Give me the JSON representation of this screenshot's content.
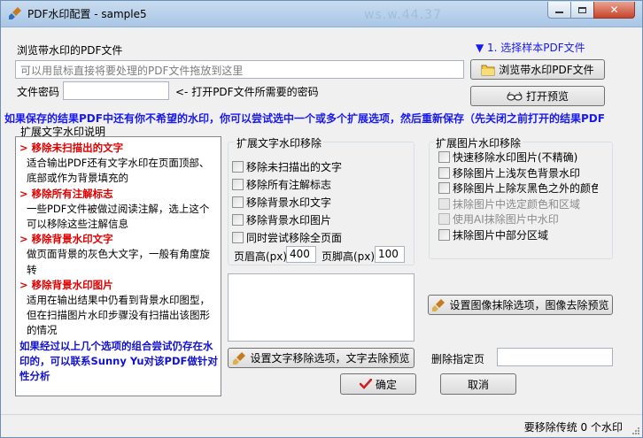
{
  "window": {
    "title": "PDF水印配置 - sample5",
    "background_text": "ws.w.44.37",
    "buttons": {
      "minimize": "–",
      "maximize": "□",
      "close": "✕"
    }
  },
  "file": {
    "browse_label": "浏览带水印的PDF文件",
    "step_link": "▼ 1. 选择样本PDF文件",
    "drop_placeholder": "可以用鼠标直接将要处理的PDF文件拖放到这里",
    "browse_button": "浏览带水印PDF文件",
    "password_label": "文件密码",
    "password_value": "",
    "password_hint": "<- 打开PDF文件所需要的密码",
    "open_preview_button": "打开预览"
  },
  "banner": "如果保存的结果PDF中还有你不希望的水印，你可以尝试选中一个或多个扩展选项，然后重新保存（先关闭之前打开的结果PDF",
  "description": {
    "group_label": "扩展文字水印说明",
    "sections": [
      {
        "heading": "> 移除未扫描出的文字",
        "text": "适合输出PDF还有文字水印在页面顶部、底部或作为背景填充的"
      },
      {
        "heading": "> 移除所有注解标志",
        "text": "一些PDF文件被做过阅读注解，选上这个可以移除这些注解信息"
      },
      {
        "heading": "> 移除背景水印文字",
        "text": "做页面背景的灰色大文字，一般有角度旋转"
      },
      {
        "heading": "> 移除背景水印图片",
        "text": "适用在输出结果中仍看到背景水印图型，但在扫描图片水印步骤没有扫描出该图形的情况"
      }
    ],
    "footer": "如果经过以上几个选项的组合尝试仍存在水印的，可以联系Sunny Yu对该PDF做针对性分析"
  },
  "text_removal": {
    "group_label": "扩展文字水印移除",
    "options": [
      {
        "label": "移除未扫描出的文字",
        "checked": false
      },
      {
        "label": "移除所有注解标志",
        "checked": false
      },
      {
        "label": "移除背景水印文字",
        "checked": false
      },
      {
        "label": "移除背景水印图片",
        "checked": false
      },
      {
        "label": "同时尝试移除全页面",
        "checked": false
      }
    ],
    "header_height_label": "页眉高(px)",
    "header_height_value": "400",
    "footer_height_label": "页脚高(px)",
    "footer_height_value": "100",
    "notes_value": "",
    "settings_button": "设置文字移除选项，文字去除预览"
  },
  "image_removal": {
    "group_label": "扩展图片水印移除",
    "options": [
      {
        "label": "快速移除水印图片(不精确)",
        "checked": false,
        "enabled": true
      },
      {
        "label": "移除图片上浅灰色背景水印",
        "checked": false,
        "enabled": true
      },
      {
        "label": "移除图片上除灰黑色之外的颜色",
        "checked": false,
        "enabled": true
      },
      {
        "label": "抹除图片中选定颜色和区域",
        "checked": false,
        "enabled": false
      },
      {
        "label": "使用AI抹除图片中水印",
        "checked": false,
        "enabled": false
      },
      {
        "label": "抹除图片中部分区域",
        "checked": false,
        "enabled": true
      }
    ],
    "settings_button": "设置图像抹除选项，图像去除预览"
  },
  "delete_pages": {
    "label": "删除指定页",
    "value": ""
  },
  "actions": {
    "ok": "确定",
    "cancel": "取消"
  },
  "status": "要移除传统 0 个水印",
  "colors": {
    "accent_blue": "#1a1aee",
    "heading_red": "#e00000",
    "ok_check": "#d02020"
  }
}
